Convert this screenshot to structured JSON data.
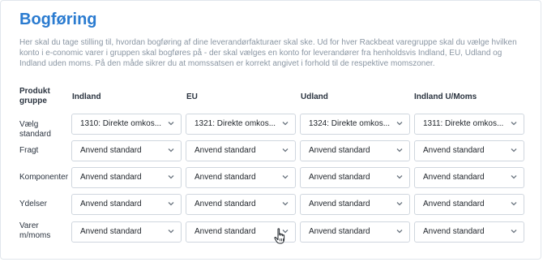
{
  "page": {
    "title": "Bogføring",
    "description": "Her skal du tage stilling til, hvordan bogføring af dine leverandørfakturaer skal ske. Ud for hver Rackbeat varegruppe skal du vælge hvilken konto i e-conomic varer i gruppen skal bogføres på - der skal vælges en konto for leverandører fra henholdsvis Indland, EU, Udland og Indland uden moms. På den måde sikrer du at momssatsen er korrekt angivet i forhold til de respektive momszoner."
  },
  "table": {
    "headers": {
      "group": "Produkt gruppe",
      "indland": "Indland",
      "eu": "EU",
      "udland": "Udland",
      "indland_umoms": "Indland U/Moms"
    },
    "rows": [
      {
        "label": "Vælg standard",
        "values": [
          "1310: Direkte omkos...",
          "1321: Direkte omkos...",
          "1324: Direkte omkos...",
          "1311: Direkte omkos..."
        ]
      },
      {
        "label": "Fragt",
        "values": [
          "Anvend standard",
          "Anvend standard",
          "Anvend standard",
          "Anvend standard"
        ]
      },
      {
        "label": "Komponenter",
        "values": [
          "Anvend standard",
          "Anvend standard",
          "Anvend standard",
          "Anvend standard"
        ]
      },
      {
        "label": "Ydelser",
        "values": [
          "Anvend standard",
          "Anvend standard",
          "Anvend standard",
          "Anvend standard"
        ]
      },
      {
        "label": "Varer m/moms",
        "values": [
          "Anvend standard",
          "Anvend standard",
          "Anvend standard",
          "Anvend standard"
        ]
      }
    ]
  },
  "icons": {
    "dropdown": "chevron-down-icon",
    "cursor": "hand-pointer-icon"
  },
  "colors": {
    "title": "#2a7bd0",
    "description": "#8a96a3",
    "border": "#cfd6de"
  }
}
